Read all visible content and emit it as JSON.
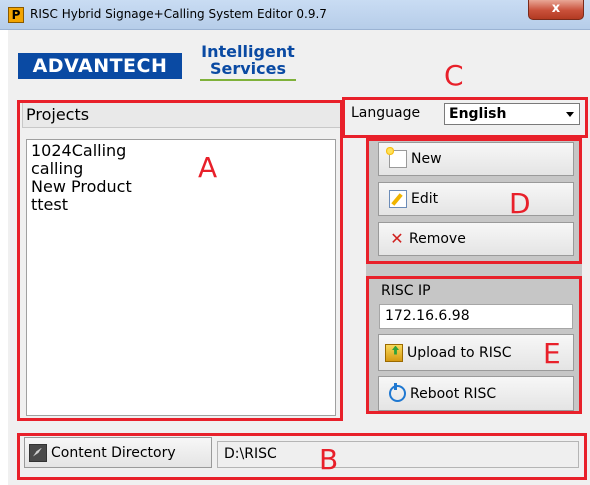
{
  "window": {
    "title": "RISC Hybrid Signage+Calling System Editor 0.9.7",
    "app_icon_letter": "P",
    "close_label": "x"
  },
  "branding": {
    "advantech": "ADVANTECH",
    "intelligent_line1": "Intelligent",
    "intelligent_line2": "Services"
  },
  "projects": {
    "header": "Projects",
    "items": [
      "1024Calling",
      "calling",
      "New Product",
      "ttest"
    ]
  },
  "language": {
    "label": "Language",
    "selected": "English"
  },
  "actions": {
    "new_label": "New",
    "edit_label": "Edit",
    "remove_label": "Remove"
  },
  "risc": {
    "ip_label": "RISC IP",
    "ip_value": "172.16.6.98",
    "upload_label": "Upload to RISC",
    "reboot_label": "Reboot RISC"
  },
  "content_directory": {
    "button_label": "Content Directory",
    "path": "D:\\RISC"
  },
  "annotations": {
    "a": "A",
    "b": "B",
    "c": "C",
    "d": "D",
    "e": "E"
  },
  "colors": {
    "annotation_red": "#e8202a",
    "brand_blue": "#0a4aa3"
  }
}
